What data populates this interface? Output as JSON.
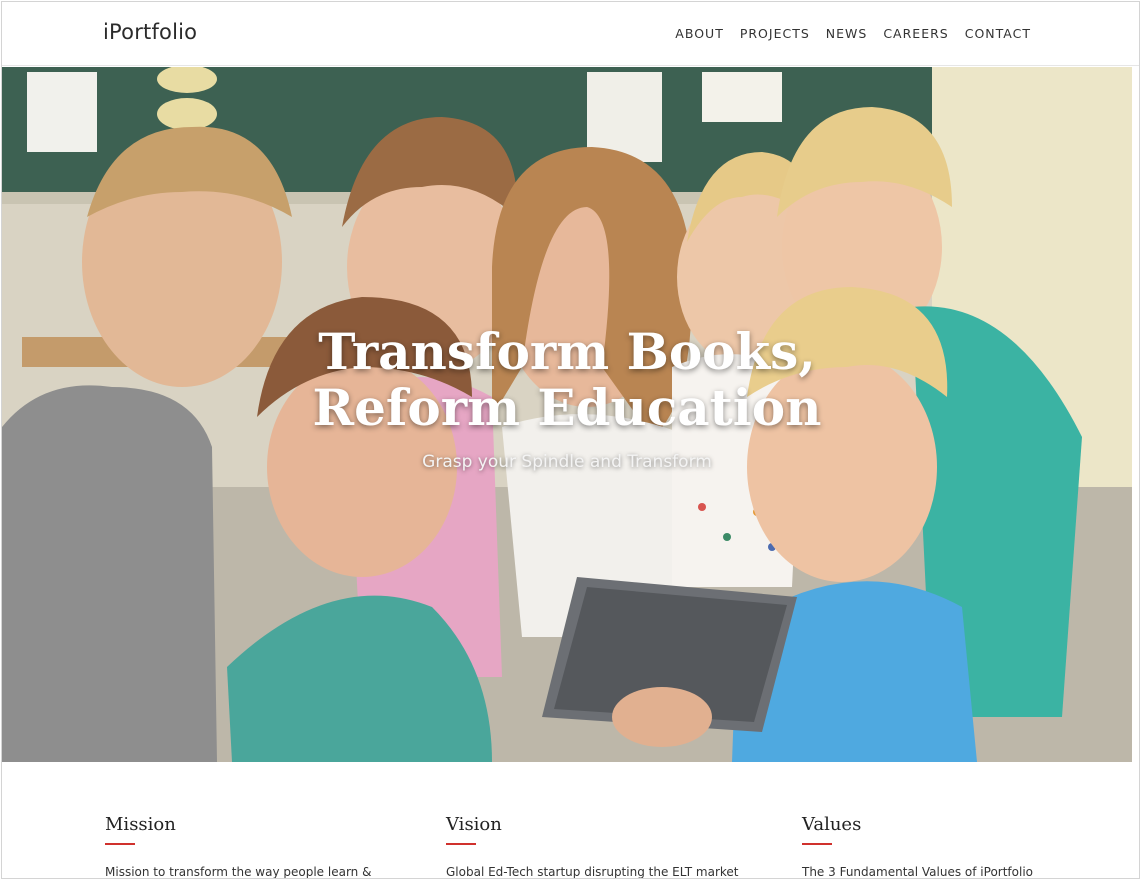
{
  "header": {
    "brand": "iPortfolio",
    "nav": [
      "ABOUT",
      "PROJECTS",
      "NEWS",
      "CAREERS",
      "CONTACT"
    ]
  },
  "hero": {
    "title_line1": "Transform Books,",
    "title_line2": "Reform Education",
    "subtitle": "Grasp your Spindle and Transform"
  },
  "columns": [
    {
      "heading": "Mission",
      "text": "Mission to transform the way people learn &"
    },
    {
      "heading": "Vision",
      "text": "Global Ed-Tech startup disrupting the ELT market"
    },
    {
      "heading": "Values",
      "text": "The 3 Fundamental Values of iPortfolio"
    }
  ],
  "colors": {
    "accent": "#d0312d",
    "text": "#333333"
  }
}
